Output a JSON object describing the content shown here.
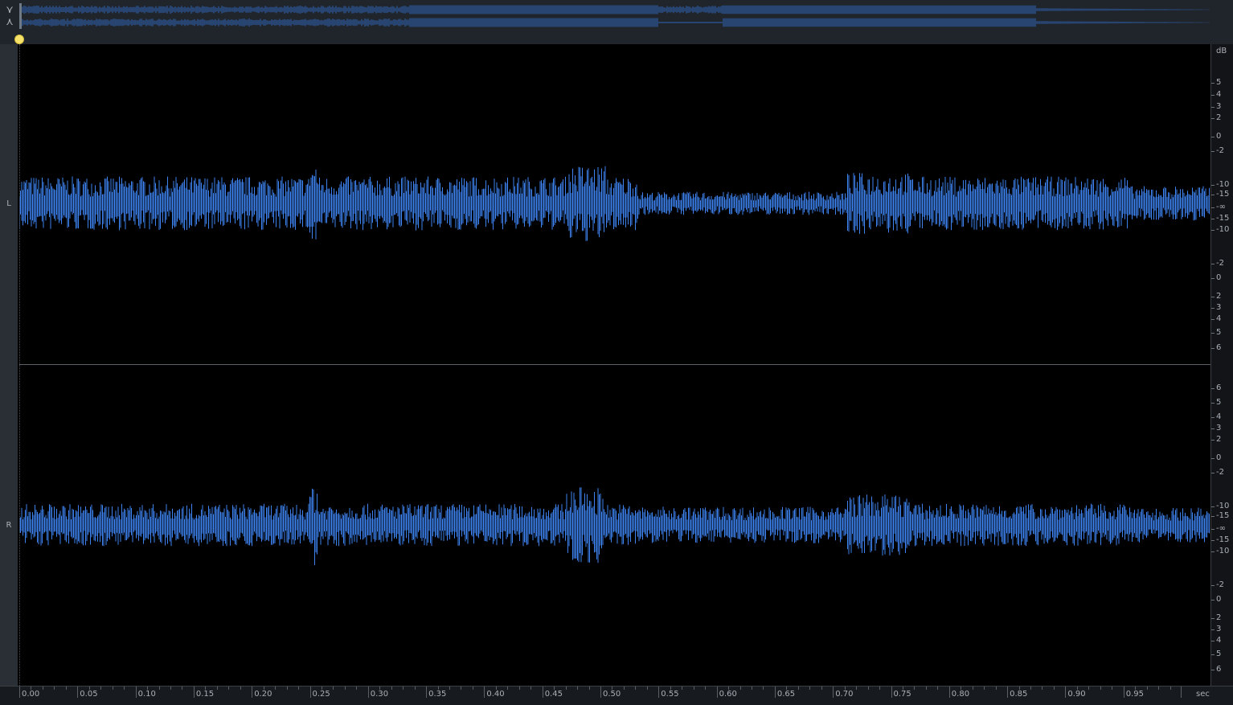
{
  "overview": {
    "nav": {
      "collapse_icon": "⋎",
      "expand_icon": "⋏"
    }
  },
  "channels": [
    {
      "label": "L"
    },
    {
      "label": "R"
    }
  ],
  "db_scale": {
    "unit": "dB",
    "upper": [
      "5",
      "4",
      "3",
      "2",
      "0",
      "-2",
      "-10",
      "-15",
      "-∞",
      "-15",
      "-10",
      "-2",
      "0",
      "2",
      "3",
      "4",
      "5",
      "6"
    ],
    "lower": [
      "6",
      "5",
      "4",
      "3",
      "2",
      "0",
      "-2",
      "-10",
      "-15",
      "-∞",
      "-15",
      "-10",
      "-2",
      "0",
      "2",
      "3",
      "4",
      "5",
      "6"
    ]
  },
  "time_ruler": {
    "ticks": [
      "0.00",
      "0.05",
      "0.10",
      "0.15",
      "0.20",
      "0.25",
      "0.30",
      "0.35",
      "0.40",
      "0.45",
      "0.50",
      "0.55",
      "0.60",
      "0.65",
      "0.70",
      "0.75",
      "0.80",
      "0.85",
      "0.90",
      "0.95"
    ],
    "unit": "sec"
  },
  "colors": {
    "waveform": "#3d82ee",
    "overview_wave": "#2f64b4",
    "playhead": "#f7e36a",
    "background": "#000000",
    "panel": "#20242b"
  }
}
